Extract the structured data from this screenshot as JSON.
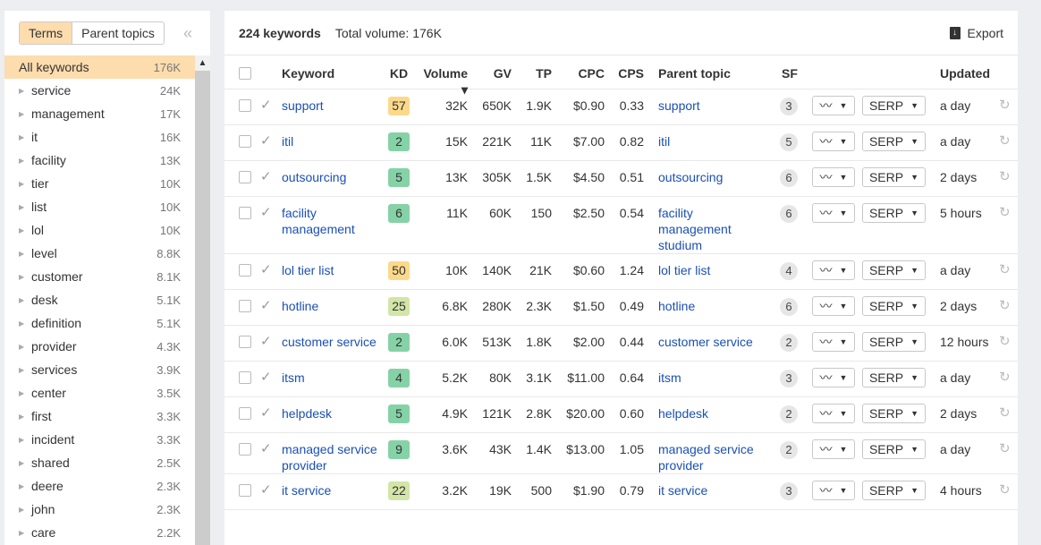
{
  "sidebar": {
    "tabs": [
      "Terms",
      "Parent topics"
    ],
    "active_tab": "Terms",
    "collapse_icon": "double-chevron-left-icon",
    "all": {
      "label": "All keywords",
      "count": "176K"
    },
    "items": [
      [
        "service",
        "24K"
      ],
      [
        "management",
        "17K"
      ],
      [
        "it",
        "16K"
      ],
      [
        "facility",
        "13K"
      ],
      [
        "tier",
        "10K"
      ],
      [
        "list",
        "10K"
      ],
      [
        "lol",
        "10K"
      ],
      [
        "level",
        "8.8K"
      ],
      [
        "customer",
        "8.1K"
      ],
      [
        "desk",
        "5.1K"
      ],
      [
        "definition",
        "5.1K"
      ],
      [
        "provider",
        "4.3K"
      ],
      [
        "services",
        "3.9K"
      ],
      [
        "center",
        "3.5K"
      ],
      [
        "first",
        "3.3K"
      ],
      [
        "incident",
        "3.3K"
      ],
      [
        "shared",
        "2.5K"
      ],
      [
        "deere",
        "2.3K"
      ],
      [
        "john",
        "2.3K"
      ],
      [
        "care",
        "2.2K"
      ]
    ]
  },
  "header": {
    "count": "224 keywords",
    "total_volume": "Total volume: 176K",
    "export": "Export"
  },
  "columns": [
    "Keyword",
    "KD",
    "Volume ▾",
    "GV",
    "TP",
    "CPC",
    "CPS",
    "Parent topic",
    "SF",
    "Updated"
  ],
  "colors": {
    "kd_yellow": "#fcd98a",
    "kd_lightgreen": "#d3e5a7",
    "kd_green": "#86d2a7",
    "link": "#1a4fb5",
    "selected": "#fddcae"
  },
  "serp_label": "SERP",
  "rows": [
    {
      "keyword": "support",
      "kd": "57",
      "volume": "32K",
      "gv": "650K",
      "tp": "1.9K",
      "cpc": "$0.90",
      "cps": "0.33",
      "parent": "support",
      "sf": "3",
      "updated": "a day"
    },
    {
      "keyword": "itil",
      "kd": "2",
      "volume": "15K",
      "gv": "221K",
      "tp": "11K",
      "cpc": "$7.00",
      "cps": "0.82",
      "parent": "itil",
      "sf": "5",
      "updated": "a day"
    },
    {
      "keyword": "outsourcing",
      "kd": "5",
      "volume": "13K",
      "gv": "305K",
      "tp": "1.5K",
      "cpc": "$4.50",
      "cps": "0.51",
      "parent": "outsourcing",
      "sf": "6",
      "updated": "2 days"
    },
    {
      "keyword": "facility management",
      "kd": "6",
      "volume": "11K",
      "gv": "60K",
      "tp": "150",
      "cpc": "$2.50",
      "cps": "0.54",
      "parent": "facility management studium",
      "sf": "6",
      "updated": "5 hours"
    },
    {
      "keyword": "lol tier list",
      "kd": "50",
      "volume": "10K",
      "gv": "140K",
      "tp": "21K",
      "cpc": "$0.60",
      "cps": "1.24",
      "parent": "lol tier list",
      "sf": "4",
      "updated": "a day"
    },
    {
      "keyword": "hotline",
      "kd": "25",
      "volume": "6.8K",
      "gv": "280K",
      "tp": "2.3K",
      "cpc": "$1.50",
      "cps": "0.49",
      "parent": "hotline",
      "sf": "6",
      "updated": "2 days"
    },
    {
      "keyword": "customer service",
      "kd": "2",
      "volume": "6.0K",
      "gv": "513K",
      "tp": "1.8K",
      "cpc": "$2.00",
      "cps": "0.44",
      "parent": "customer service",
      "sf": "2",
      "updated": "12 hours"
    },
    {
      "keyword": "itsm",
      "kd": "4",
      "volume": "5.2K",
      "gv": "80K",
      "tp": "3.1K",
      "cpc": "$11.00",
      "cps": "0.64",
      "parent": "itsm",
      "sf": "3",
      "updated": "a day"
    },
    {
      "keyword": "helpdesk",
      "kd": "5",
      "volume": "4.9K",
      "gv": "121K",
      "tp": "2.8K",
      "cpc": "$20.00",
      "cps": "0.60",
      "parent": "helpdesk",
      "sf": "2",
      "updated": "2 days"
    },
    {
      "keyword": "managed service provider",
      "kd": "9",
      "volume": "3.6K",
      "gv": "43K",
      "tp": "1.4K",
      "cpc": "$13.00",
      "cps": "1.05",
      "parent": "managed service provider",
      "sf": "2",
      "updated": "a day"
    },
    {
      "keyword": "it service",
      "kd": "22",
      "volume": "3.2K",
      "gv": "19K",
      "tp": "500",
      "cpc": "$1.90",
      "cps": "0.79",
      "parent": "it service",
      "sf": "3",
      "updated": "4 hours"
    }
  ]
}
